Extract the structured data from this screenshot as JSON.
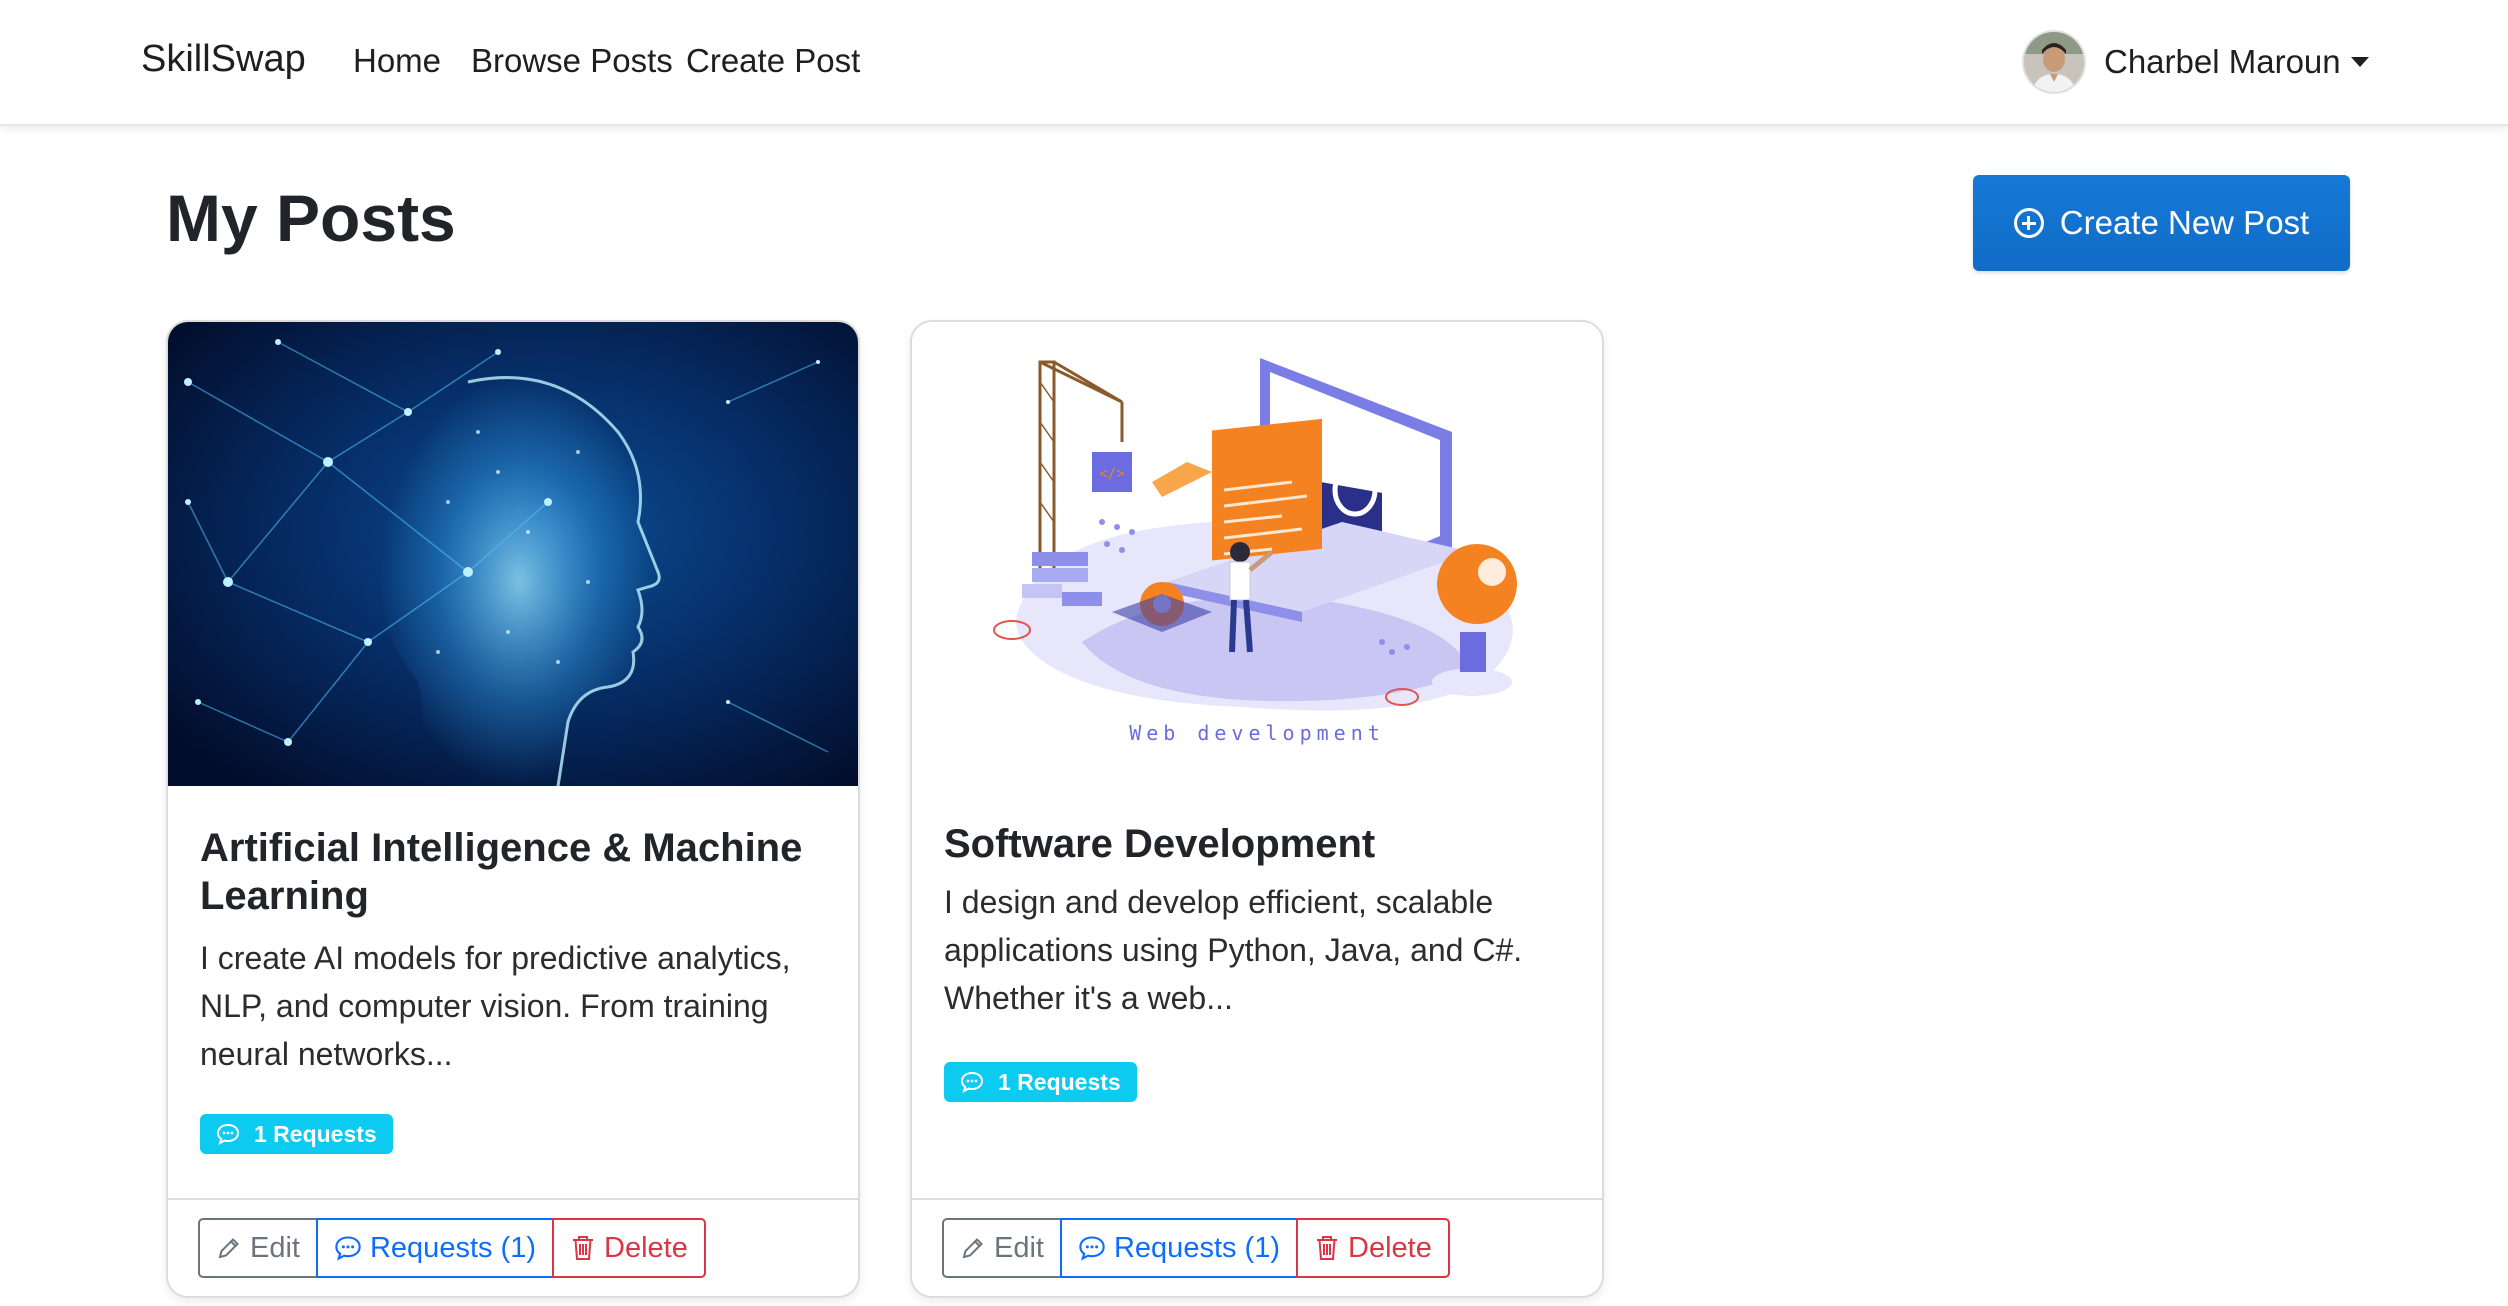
{
  "navbar": {
    "brand": "SkillSwap",
    "links": [
      "Home",
      "Browse Posts",
      "Create Post"
    ],
    "user_name": "Charbel Maroun"
  },
  "page": {
    "title": "My Posts",
    "create_button": "Create New Post"
  },
  "posts": [
    {
      "title": "Artificial Intelligence & Machine Learning",
      "description": "I create AI models for predictive analytics, NLP, and computer vision. From training neural networks...",
      "badge": "1 Requests",
      "image_icon": "ai-head-network-image",
      "actions": {
        "edit": "Edit",
        "requests": "Requests (1)",
        "delete": "Delete"
      }
    },
    {
      "title": "Software Development",
      "description": "I design and develop efficient, scalable applications using Python, Java, and C#. Whether it's a web...",
      "badge": "1 Requests",
      "image_icon": "web-development-illustration",
      "image_caption": "Web development",
      "actions": {
        "edit": "Edit",
        "requests": "Requests (1)",
        "delete": "Delete"
      }
    }
  ],
  "colors": {
    "primary": "#0d6efd",
    "info": "#0dcaf0",
    "danger": "#dc3545",
    "secondary": "#6c757d"
  }
}
